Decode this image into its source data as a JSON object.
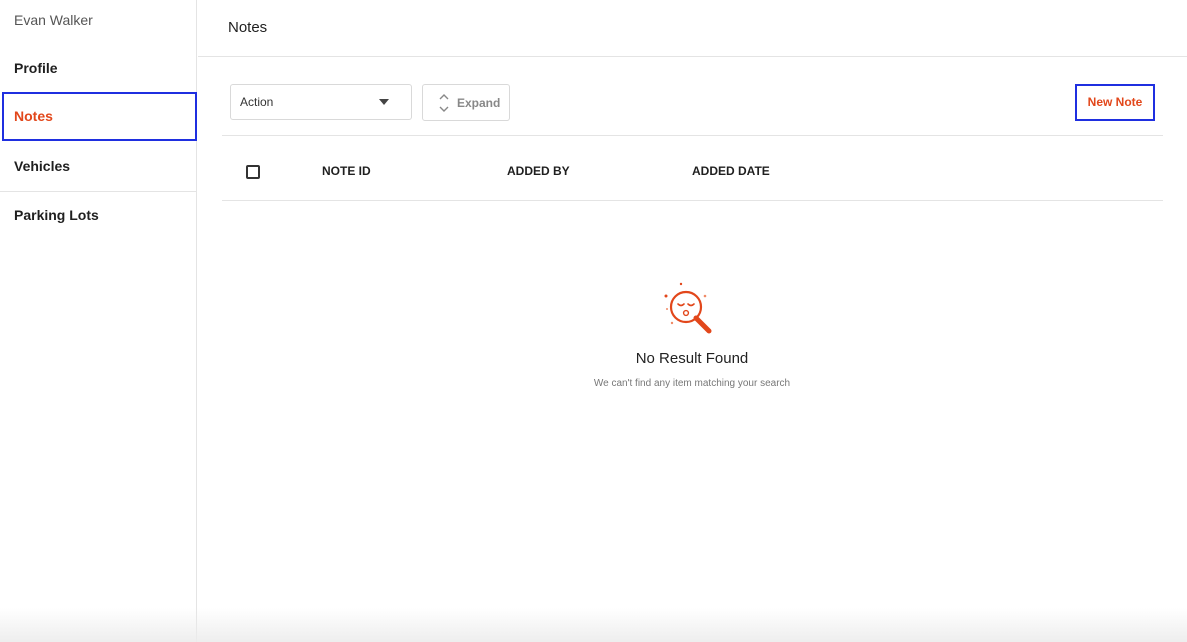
{
  "sidebar": {
    "user_name": "Evan Walker",
    "items": [
      {
        "label": "Profile"
      },
      {
        "label": "Notes",
        "active": true
      },
      {
        "label": "Vehicles"
      },
      {
        "label": "Parking Lots"
      }
    ]
  },
  "header": {
    "title": "Notes"
  },
  "toolbar": {
    "action_label": "Action",
    "expand_label": "Expand",
    "new_note_label": "New Note"
  },
  "table": {
    "columns": [
      "NOTE ID",
      "ADDED BY",
      "ADDED DATE"
    ],
    "rows": []
  },
  "empty_state": {
    "title": "No Result Found",
    "message": "We can't find any item matching your search",
    "icon": "magnifier-sad-face-icon"
  },
  "colors": {
    "accent": "#e2471b",
    "highlight_border": "#1f2fe0"
  }
}
